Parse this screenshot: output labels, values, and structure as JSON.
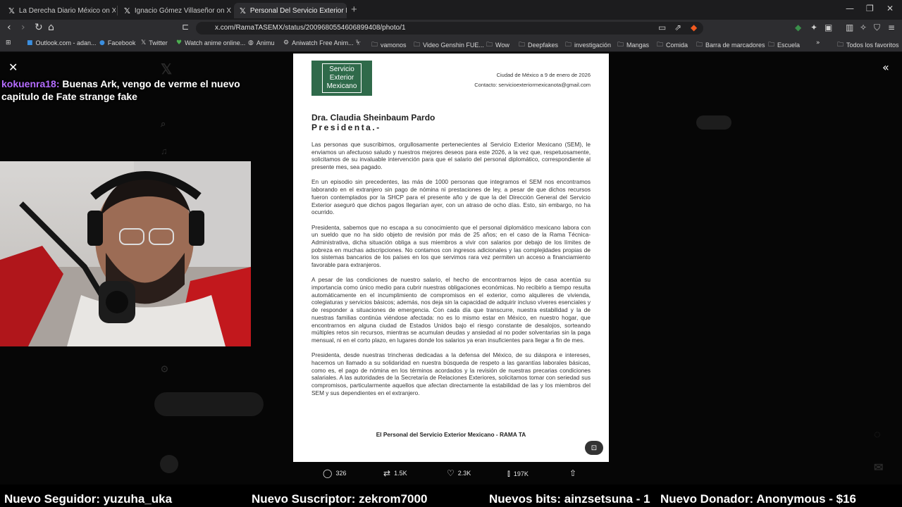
{
  "browser": {
    "tabs": [
      {
        "title": "La Derecha Diario México on X: \"",
        "active": false
      },
      {
        "title": "Ignacio Gómez Villaseñor on X: \"",
        "active": false
      },
      {
        "title": "Personal Del Servicio Exterior Me",
        "active": true
      }
    ],
    "url": "x.com/RamaTASEMX/status/2009680554606899408/photo/1",
    "bookmarks": [
      {
        "label": "Outlook.com - adan...",
        "icon": "outlook-icon"
      },
      {
        "label": "Facebook",
        "icon": "facebook-icon"
      },
      {
        "label": "Twitter",
        "icon": "x-icon"
      },
      {
        "label": "Watch anime online...",
        "icon": "anime-icon"
      },
      {
        "label": "Animu",
        "icon": "globe-icon"
      },
      {
        "label": "Aniwatch Free Anim...",
        "icon": "aniwatch-icon"
      },
      {
        "label": "vamonos",
        "icon": "folder-icon"
      },
      {
        "label": "Video Genshin FUE...",
        "icon": "folder-icon"
      },
      {
        "label": "Wow",
        "icon": "folder-icon"
      },
      {
        "label": "Deepfakes",
        "icon": "folder-icon"
      },
      {
        "label": "investigación",
        "icon": "folder-icon"
      },
      {
        "label": "Mangas",
        "icon": "folder-icon"
      },
      {
        "label": "Comida",
        "icon": "folder-icon"
      },
      {
        "label": "Barra de marcadores",
        "icon": "folder-icon"
      },
      {
        "label": "Escuela",
        "icon": "folder-icon"
      }
    ],
    "all_bookmarks": "Todos los favoritos"
  },
  "chat": {
    "user": "kokuenra18:",
    "message": "Buenas Ark, vengo de verme el nuevo capitulo de Fate strange fake"
  },
  "letter": {
    "logo_text": [
      "Servicio",
      "Exterior",
      "Mexicano"
    ],
    "place_date": "Ciudad de México a 9 de enero de 2026",
    "contact": "Contacto: servicioexteriormexicanota@gmail.com",
    "recipient_name": "Dra. Claudia Sheinbaum Pardo",
    "recipient_role": "Presidenta.-",
    "paragraphs": [
      "Las personas que suscribimos, orgullosamente pertenecientes al Servicio Exterior Mexicano (SEM), le enviamos un afectuoso saludo y nuestros mejores deseos para este 2026, a la vez que, respetuosamente, solicitamos de su invaluable intervención para que el salario del personal diplomático, correspondiente al presente mes, sea pagado.",
      "En un episodio sin precedentes, las más de 1000 personas que integramos el SEM nos encontramos laborando en el extranjero sin pago de nómina ni prestaciones de ley, a pesar de que dichos recursos fueron contemplados por la SHCP para el presente año y de que la del Dirección General del Servicio Exterior aseguró que dichos pagos llegarían ayer, con un atraso de ocho días. Esto, sin embargo, no ha ocurrido.",
      "Presidenta, sabemos que no escapa a su conocimiento que el personal diplomático mexicano labora con un sueldo que no ha sido objeto de revisión por más de 25 años; en el caso de la Rama Técnica-Administrativa, dicha situación obliga a sus miembros a vivir con salarios por debajo de los límites de pobreza en muchas adscripciones. No contamos con ingresos adicionales y las complejidades propias de los sistemas bancarios de los países en los que servimos rara vez permiten un acceso a financiamiento favorable para extranjeros.",
      "A pesar de las condiciones de nuestro salario, el hecho de encontrarnos lejos de casa acentúa su importancia como único medio para cubrir nuestras obligaciones económicas. No recibirlo a tiempo resulta automáticamente en el incumplimiento de compromisos en el exterior, como alquileres de vivienda, colegiaturas y servicios básicos; además, nos deja sin la capacidad de adquirir incluso víveres esenciales y de responder a situaciones de emergencia. Con cada día que transcurre, nuestra estabilidad y la de nuestras familias continúa viéndose afectada: no es lo mismo estar en México, en nuestro hogar, que encontrarnos en alguna ciudad de Estados Unidos bajo el riesgo constante de desalojos, sorteando múltiples retos sin recursos, mientras se acumulan deudas y ansiedad al no poder solventarias sin la paga mensual, ni en el corto plazo, en lugares donde los salarios ya eran insuficientes para llegar a fin de mes.",
      "Presidenta, desde nuestras trincheras dedicadas a la defensa del México, de su diáspora e intereses, hacemos un llamado a su solidaridad en nuestra búsqueda de respeto a las garantías laborales básicas, como es, el pago de nómina en los términos acordados y la revisión de nuestras precarias condiciones salariales. A las autoridades de la Secretaría de Relaciones Exteriores, solicitamos tomar con seriedad sus compromisos, particularmente aquellos que afectan directamente la estabilidad de las y los miembros del SEM y sus dependientes en el extranjero."
    ],
    "signoff": "El Personal del Servicio Exterior Mexicano - RAMA TA"
  },
  "post_actions": {
    "replies": "326",
    "reposts": "1.5K",
    "likes": "2.3K",
    "views": "197K"
  },
  "stream_alerts": {
    "follower": "Nuevo Seguidor: yuzuha_uka",
    "subscriber": "Nuevo Suscriptor: zekrom7000",
    "bits": "Nuevos bits: ainzsetsuna - 1",
    "donor": "Nuevo Donador: Anonymous - $16"
  },
  "colors": {
    "logo_green": "#2f6a4a",
    "chat_username": "#b46cff",
    "browser_chrome": "#2d2d30"
  }
}
